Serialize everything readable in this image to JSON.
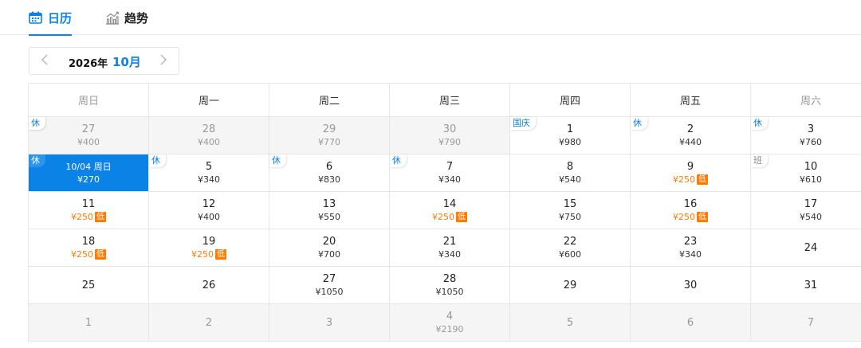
{
  "tabs": {
    "calendar_label": "日历",
    "trend_label": "趋势"
  },
  "picker": {
    "year": "2026年",
    "month": "10月"
  },
  "colors": {
    "accent": "#0a82e6",
    "low_price": "#ff7a00"
  },
  "weekdays": [
    "周日",
    "周一",
    "周二",
    "周三",
    "周四",
    "周五",
    "周六"
  ],
  "weeks": [
    [
      {
        "num": "27",
        "price": "¥400",
        "outside": true,
        "tag": "休",
        "tag_type": "holiday"
      },
      {
        "num": "28",
        "price": "¥400",
        "outside": true
      },
      {
        "num": "29",
        "price": "¥770",
        "outside": true
      },
      {
        "num": "30",
        "price": "¥790",
        "outside": true
      },
      {
        "num": "1",
        "price": "¥980",
        "tag": "国庆",
        "tag_type": "holiday"
      },
      {
        "num": "2",
        "price": "¥440",
        "tag": "休",
        "tag_type": "holiday"
      },
      {
        "num": "3",
        "price": "¥760",
        "tag": "休",
        "tag_type": "holiday"
      }
    ],
    [
      {
        "num": "10/04 周日",
        "price": "¥270",
        "selected": true,
        "tag": "休",
        "tag_type": "holiday"
      },
      {
        "num": "5",
        "price": "¥340",
        "tag": "休",
        "tag_type": "holiday"
      },
      {
        "num": "6",
        "price": "¥830",
        "tag": "休",
        "tag_type": "holiday"
      },
      {
        "num": "7",
        "price": "¥340",
        "tag": "休",
        "tag_type": "holiday"
      },
      {
        "num": "8",
        "price": "¥540"
      },
      {
        "num": "9",
        "price": "¥250",
        "low": true
      },
      {
        "num": "10",
        "price": "¥610",
        "tag": "班",
        "tag_type": "work"
      }
    ],
    [
      {
        "num": "11",
        "price": "¥250",
        "low": true
      },
      {
        "num": "12",
        "price": "¥400"
      },
      {
        "num": "13",
        "price": "¥550"
      },
      {
        "num": "14",
        "price": "¥250",
        "low": true
      },
      {
        "num": "15",
        "price": "¥750"
      },
      {
        "num": "16",
        "price": "¥250",
        "low": true
      },
      {
        "num": "17",
        "price": "¥540"
      }
    ],
    [
      {
        "num": "18",
        "price": "¥250",
        "low": true
      },
      {
        "num": "19",
        "price": "¥250",
        "low": true
      },
      {
        "num": "20",
        "price": "¥700"
      },
      {
        "num": "21",
        "price": "¥340"
      },
      {
        "num": "22",
        "price": "¥600"
      },
      {
        "num": "23",
        "price": "¥340"
      },
      {
        "num": "24",
        "price": ""
      }
    ],
    [
      {
        "num": "25",
        "price": ""
      },
      {
        "num": "26",
        "price": ""
      },
      {
        "num": "27",
        "price": "¥1050"
      },
      {
        "num": "28",
        "price": "¥1050"
      },
      {
        "num": "29",
        "price": ""
      },
      {
        "num": "30",
        "price": ""
      },
      {
        "num": "31",
        "price": ""
      }
    ],
    [
      {
        "num": "1",
        "price": "",
        "outside": true
      },
      {
        "num": "2",
        "price": "",
        "outside": true
      },
      {
        "num": "3",
        "price": "",
        "outside": true
      },
      {
        "num": "4",
        "price": "¥2190",
        "outside": true
      },
      {
        "num": "5",
        "price": "",
        "outside": true
      },
      {
        "num": "6",
        "price": "",
        "outside": true
      },
      {
        "num": "7",
        "price": "",
        "outside": true
      }
    ]
  ],
  "low_badge": "低"
}
